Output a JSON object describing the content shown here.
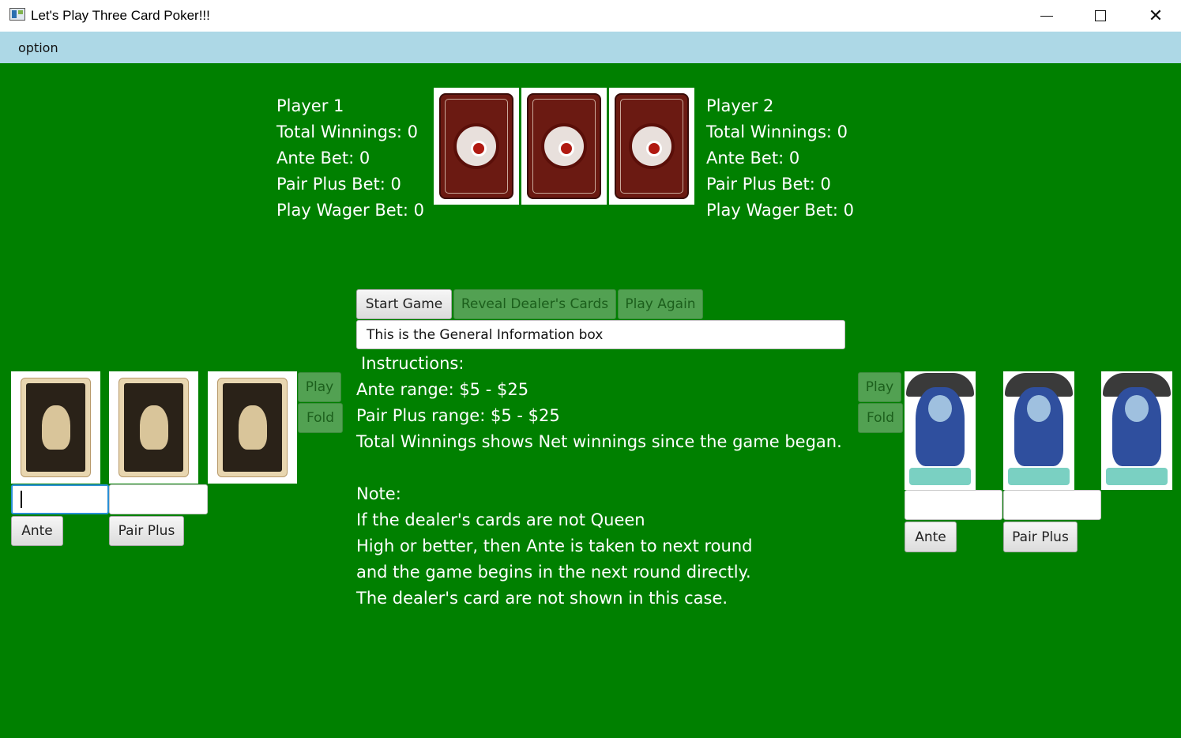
{
  "window": {
    "title": "Let's Play Three Card Poker!!!",
    "controls": {
      "minimize": "—",
      "maximize": "☐",
      "close": "✕"
    }
  },
  "menu": {
    "option": "option"
  },
  "player1": {
    "name": "Player 1",
    "total_winnings": "Total Winnings: 0",
    "ante_bet": "Ante Bet: 0",
    "pair_plus_bet": "Pair Plus Bet: 0",
    "play_wager_bet": "Play Wager Bet: 0",
    "play_label": "Play",
    "fold_label": "Fold",
    "ante_label": "Ante",
    "pair_plus_label": "Pair Plus",
    "ante_value": "",
    "pair_plus_value": ""
  },
  "player2": {
    "name": "Player 2",
    "total_winnings": "Total Winnings: 0",
    "ante_bet": "Ante Bet: 0",
    "pair_plus_bet": "Pair Plus Bet: 0",
    "play_wager_bet": "Play Wager Bet: 0",
    "play_label": "Play",
    "fold_label": "Fold",
    "ante_label": "Ante",
    "pair_plus_label": "Pair Plus",
    "ante_value": "",
    "pair_plus_value": ""
  },
  "controls": {
    "start_game": "Start Game",
    "reveal_dealer_cards": "Reveal Dealer's Cards",
    "play_again": "Play Again"
  },
  "general_info": "This is the General Information box",
  "instructions": {
    "heading": "Instructions:",
    "ante_range": "Ante range: $5 - $25",
    "pair_plus_range": "Pair Plus range: $5 - $25",
    "total_winnings_note": "Total Winnings shows Net winnings since the game began.",
    "note_heading": "Note:",
    "note_line1": "If the dealer's cards are not Queen",
    "note_line2": "High or better, then Ante is taken to next round",
    "note_line3": "and the game begins in the next round directly.",
    "note_line4": "The dealer's card are not shown in this case."
  },
  "colors": {
    "table": "#008000",
    "menubar": "#add8e6",
    "disabled_button": "#52a152"
  },
  "icons": {
    "dealer_card": "card-back-red-mandala",
    "player1_card": "card-back-skull",
    "player2_card": "card-back-joker"
  }
}
